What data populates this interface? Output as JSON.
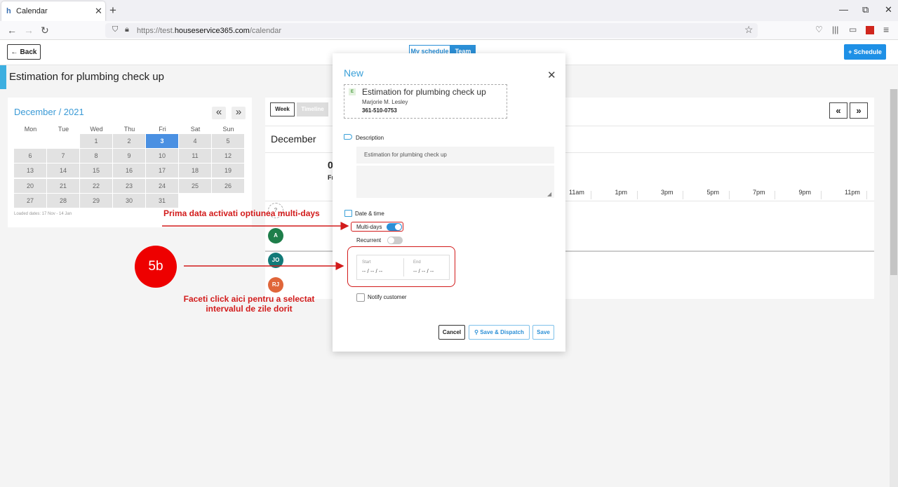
{
  "browser": {
    "tab_title": "Calendar",
    "url_prefix": "https://test.",
    "url_domain": "houseservice365.com",
    "url_path": "/calendar"
  },
  "toolbar": {
    "back_label": "Back",
    "my_schedule_label": "My schedule",
    "team_label": "Team",
    "schedule_label": "Schedule"
  },
  "page_title": "Estimation for plumbing check up",
  "mini_calendar": {
    "title": "December / 2021",
    "prev_label": "«",
    "next_label": "»",
    "weekdays": [
      "Mon",
      "Tue",
      "Wed",
      "Thu",
      "Fri",
      "Sat",
      "Sun"
    ],
    "weeks": [
      [
        "",
        "",
        "1",
        "2",
        "3",
        "4",
        "5"
      ],
      [
        "6",
        "7",
        "8",
        "9",
        "10",
        "11",
        "12"
      ],
      [
        "13",
        "14",
        "15",
        "16",
        "17",
        "18",
        "19"
      ],
      [
        "20",
        "21",
        "22",
        "23",
        "24",
        "25",
        "26"
      ],
      [
        "27",
        "28",
        "29",
        "30",
        "31",
        "",
        ""
      ]
    ],
    "selected_day": "3",
    "loaded_dates": "Loaded dates: 17 Nov - 14 Jan"
  },
  "schedule": {
    "view_week": "Week",
    "view_timeline": "Timeline",
    "month": "December",
    "day_number": "0",
    "day_abbrev": "Fr",
    "hours": [
      "11am",
      "1pm",
      "3pm",
      "5pm",
      "7pm",
      "9pm",
      "11pm"
    ],
    "avatars": [
      {
        "initials": "A",
        "color": "#1e7e4a"
      },
      {
        "initials": "JO",
        "color": "#127a78"
      },
      {
        "initials": "RJ",
        "color": "#e0663a"
      }
    ]
  },
  "modal": {
    "title": "New",
    "job": {
      "badge": "E",
      "title": "Estimation for plumbing check up",
      "customer": "Marjorie M. Lesley",
      "phone": "361-510-0753"
    },
    "description_label": "Description",
    "description_value": "Estimation for plumbing check up",
    "date_time_label": "Date & time",
    "multi_days_label": "Multi-days",
    "multi_days_on": true,
    "recurrent_label": "Recurrent",
    "recurrent_on": false,
    "start_label": "Start",
    "start_value": "-- / -- / --",
    "end_label": "End",
    "end_value": "-- / -- / --",
    "notify_label": "Notify customer",
    "cancel_label": "Cancel",
    "save_dispatch_label": "Save & Dispatch",
    "save_label": "Save"
  },
  "annotations": {
    "step": "5b",
    "multidays_note": "Prima data  activati optiunea multi-days",
    "click_note_line1": "Faceti click aici pentru a selectat",
    "click_note_line2": "intervalul de zile dorit"
  },
  "colors": {
    "accent": "#2b8fd6",
    "annotation_red": "#d21b1b",
    "today": "#4a90e2"
  }
}
